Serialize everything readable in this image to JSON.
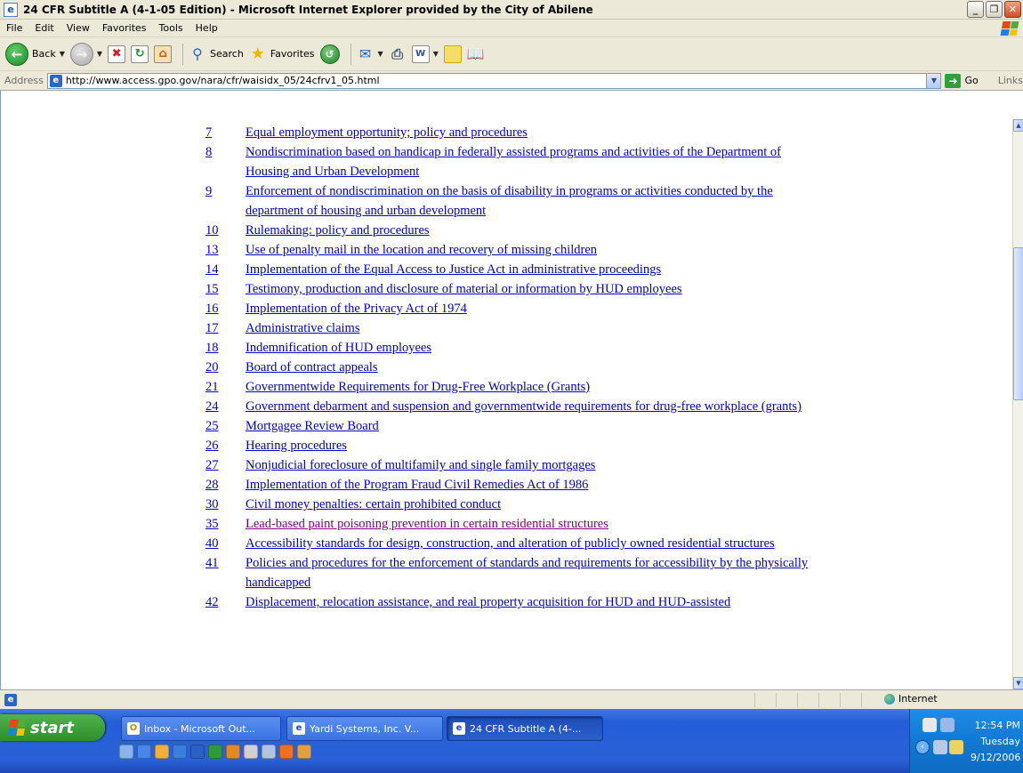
{
  "window": {
    "title": "24 CFR Subtitle A (4-1-05 Edition) - Microsoft Internet Explorer provided by the City of Abilene",
    "minimize_glyph": "_",
    "restore_glyph": "❐",
    "close_glyph": "✕"
  },
  "menu": [
    "File",
    "Edit",
    "View",
    "Favorites",
    "Tools",
    "Help"
  ],
  "toolbar": {
    "back_label": "Back",
    "search_label": "Search",
    "favorites_label": "Favorites"
  },
  "address": {
    "label": "Address",
    "url": "http://www.access.gpo.gov/nara/cfr/waisidx_05/24cfrv1_05.html",
    "go_label": "Go",
    "links_label": "Links"
  },
  "toc": [
    {
      "part": "7",
      "title": "Equal employment opportunity; policy and procedures",
      "visited": false
    },
    {
      "part": "8",
      "title": "Nondiscrimination based on handicap in federally assisted programs and activities of the Department of Housing and Urban Development",
      "visited": false
    },
    {
      "part": "9",
      "title": "Enforcement of nondiscrimination on the basis of disability in programs or activities conducted by the department of housing and urban development",
      "visited": false
    },
    {
      "part": "10",
      "title": "Rulemaking: policy and procedures",
      "visited": false
    },
    {
      "part": "13",
      "title": "Use of penalty mail in the location and recovery of missing children",
      "visited": false
    },
    {
      "part": "14",
      "title": "Implementation of the Equal Access to Justice Act in administrative proceedings",
      "visited": false
    },
    {
      "part": "15",
      "title": "Testimony, production and disclosure of material or information by HUD employees",
      "visited": false
    },
    {
      "part": "16",
      "title": "Implementation of the Privacy Act of 1974",
      "visited": false
    },
    {
      "part": "17",
      "title": "Administrative claims",
      "visited": false
    },
    {
      "part": "18",
      "title": "Indemnification of HUD employees",
      "visited": false
    },
    {
      "part": "20",
      "title": "Board of contract appeals",
      "visited": false
    },
    {
      "part": "21",
      "title": "Governmentwide Requirements for Drug-Free Workplace (Grants)",
      "visited": false
    },
    {
      "part": "24",
      "title": "Government debarment and suspension and governmentwide requirements for drug-free workplace (grants)",
      "visited": false
    },
    {
      "part": "25",
      "title": "Mortgagee Review Board",
      "visited": false
    },
    {
      "part": "26",
      "title": "Hearing procedures",
      "visited": false
    },
    {
      "part": "27",
      "title": "Nonjudicial foreclosure of multifamily and single family mortgages",
      "visited": false
    },
    {
      "part": "28",
      "title": "Implementation of the Program Fraud Civil Remedies Act of 1986",
      "visited": false
    },
    {
      "part": "30",
      "title": "Civil money penalties: certain prohibited conduct",
      "visited": false
    },
    {
      "part": "35",
      "title": "Lead-based paint poisoning prevention in certain residential structures",
      "visited": true
    },
    {
      "part": "40",
      "title": "Accessibility standards for design, construction, and alteration of publicly owned residential structures",
      "visited": false
    },
    {
      "part": "41",
      "title": "Policies and procedures for the enforcement of standards and requirements for accessibility by the physically handicapped",
      "visited": false
    },
    {
      "part": "42",
      "title": "Displacement, relocation assistance, and real property acquisition for HUD and HUD-assisted",
      "visited": false
    }
  ],
  "status": {
    "zone": "Internet"
  },
  "taskbar": {
    "start_label": "start",
    "tasks": [
      {
        "label": "Inbox - Microsoft Out...",
        "active": false
      },
      {
        "label": "Yardi Systems, Inc. V...",
        "active": false
      },
      {
        "label": "24 CFR Subtitle A (4-...",
        "active": true
      }
    ],
    "clock": {
      "time": "12:54 PM",
      "day": "Tuesday",
      "date": "9/12/2006"
    }
  },
  "colors": {
    "link": "#0000cc",
    "visited_link": "#800080",
    "taskbar_blue": "#245ed8",
    "start_green": "#2e8f2a"
  }
}
